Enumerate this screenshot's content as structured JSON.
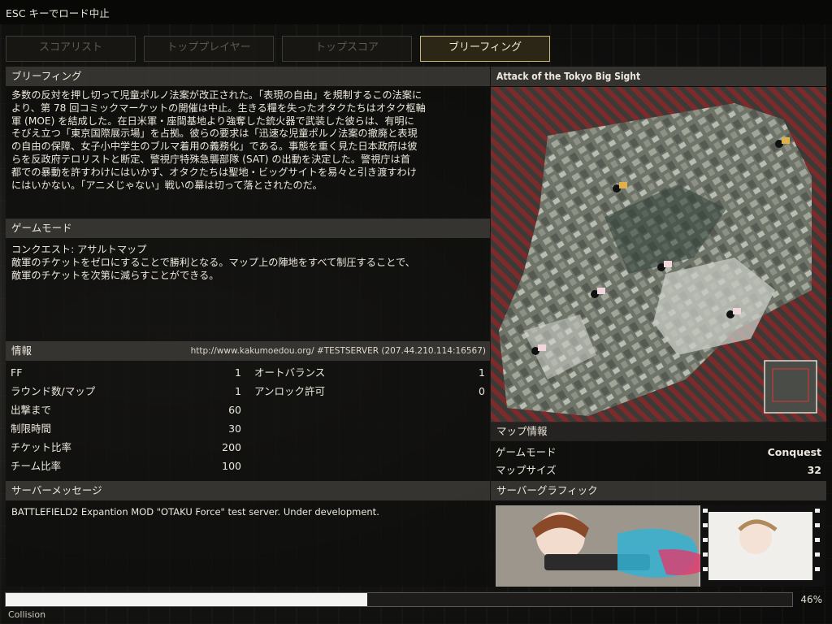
{
  "top_bar": {
    "esc_text": "ESC キーでロード中止"
  },
  "tabs": [
    {
      "label": "スコアリスト",
      "active": false
    },
    {
      "label": "トッププレイヤー",
      "active": false
    },
    {
      "label": "トップスコア",
      "active": false
    },
    {
      "label": "ブリーフィング",
      "active": true
    }
  ],
  "briefing": {
    "header": "ブリーフィング",
    "lines": [
      "多数の反対を押し切って児童ポルノ法案が改正された。「表現の自由」を規制するこの法案に",
      "より、第 78 回コミックマーケットの開催は中止。生きる糧を失ったオタクたちはオタク枢軸",
      "軍 (MOE) を結成した。在日米軍・座間基地より強奪した銃火器で武装した彼らは、有明に",
      "そびえ立つ「東京国際展示場」を占拠。彼らの要求は「迅速な児童ポルノ法案の撤廃と表現",
      "の自由の保障、女子小中学生のブルマ着用の義務化」である。事態を重く見た日本政府は彼",
      "らを反政府テロリストと断定、警視庁特殊急襲部隊 (SAT) の出動を決定した。警視庁は首",
      "都での暴動を許すわけにはいかず、オタクたちは聖地・ビッグサイトを易々と引き渡すわけ",
      "にはいかない。「アニメじゃない」戦いの幕は切って落とされたのだ。"
    ]
  },
  "game_mode": {
    "header": "ゲームモード",
    "lines": [
      "コンクエスト: アサルトマップ",
      "敵軍のチケットをゼロにすることで勝利となる。マップ上の陣地をすべて制圧することで、",
      "敵軍のチケットを次第に減らすことができる。"
    ]
  },
  "info": {
    "header": "情報",
    "server_address": "http://www.kakumoedou.org/ #TESTSERVER (207.44.210.114:16567)",
    "left": [
      {
        "key": "FF",
        "value": "1"
      },
      {
        "key": "ラウンド数/マップ",
        "value": "1"
      },
      {
        "key": "出撃まで",
        "value": "60"
      },
      {
        "key": "制限時間",
        "value": "30"
      },
      {
        "key": "チケット比率",
        "value": "200"
      },
      {
        "key": "チーム比率",
        "value": "100"
      }
    ],
    "right": [
      {
        "key": "オートバランス",
        "value": "1"
      },
      {
        "key": "アンロック許可",
        "value": "0"
      }
    ]
  },
  "server_message": {
    "header": "サーバーメッセージ",
    "text": "BATTLEFIELD2 Expantion MOD \"OTAKU Force\" test server. Under development."
  },
  "map": {
    "title": "Attack of the Tokyo Big Sight",
    "info_header": "マップ情報",
    "game_mode_label": "ゲームモード",
    "game_mode_value": "Conquest",
    "size_label": "マップサイズ",
    "size_value": "32",
    "graphic_header": "サーバーグラフィック"
  },
  "loading": {
    "progress": 0.46,
    "percent_text": "46%",
    "status": "Collision"
  },
  "colors": {
    "active_tab_border": "#c7b879",
    "header_bg": "#3a3935",
    "map_stripes": "#8a2a2a",
    "progress_fill": "#f4f4f2"
  }
}
